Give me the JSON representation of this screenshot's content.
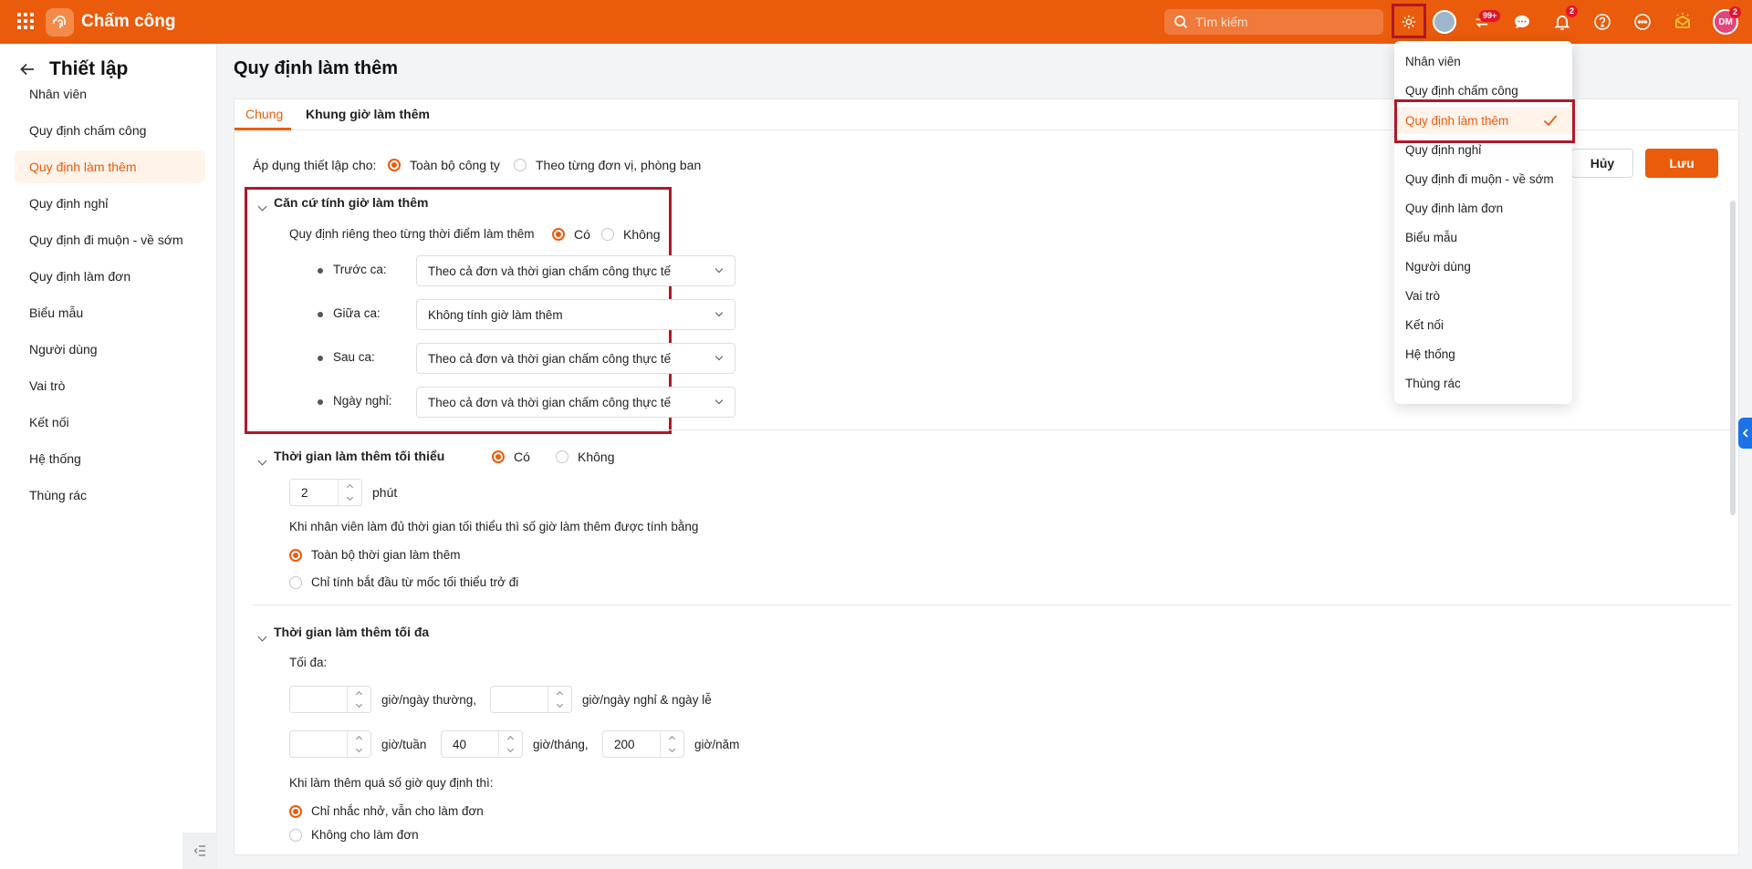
{
  "app": {
    "title": "Chấm công",
    "search_placeholder": "Tìm kiếm",
    "notif_badge": "99+",
    "bell_badge": "2",
    "avatar_initials": "DM",
    "avatar_badge": "2"
  },
  "sidebar": {
    "title": "Thiết lập",
    "items": [
      "Nhân viên",
      "Quy định chấm công",
      "Quy định làm thêm",
      "Quy định nghỉ",
      "Quy định đi muộn - về sớm",
      "Quy định làm đơn",
      "Biểu mẫu",
      "Người dùng",
      "Vai trò",
      "Kết nối",
      "Hệ thống",
      "Thùng rác"
    ],
    "active_index": 2
  },
  "page": {
    "title": "Quy định làm thêm"
  },
  "tabs": [
    "Chung",
    "Khung giờ làm thêm"
  ],
  "buttons": {
    "cancel": "Hủy",
    "save": "Lưu"
  },
  "apply": {
    "label": "Áp dụng thiết lập cho:",
    "options": [
      "Toàn bộ công ty",
      "Theo từng đơn vị, phòng ban"
    ],
    "selected": 0
  },
  "section1": {
    "title": "Căn cứ tính giờ làm thêm",
    "rule_label": "Quy định riêng theo từng thời điểm làm thêm",
    "rule_yes": "Có",
    "rule_no": "Không",
    "rows": [
      {
        "label": "Trước ca:",
        "value": "Theo cả đơn và thời gian chấm công thực tế"
      },
      {
        "label": "Giữa ca:",
        "value": "Không tính giờ làm thêm"
      },
      {
        "label": "Sau ca:",
        "value": "Theo cả đơn và thời gian chấm công thực tế"
      },
      {
        "label": "Ngày nghỉ:",
        "value": "Theo cả đơn và thời gian chấm công thực tế"
      }
    ]
  },
  "section2": {
    "title": "Thời gian làm thêm tối thiểu",
    "yes": "Có",
    "no": "Không",
    "minutes": "2",
    "unit": "phút",
    "calc_label": "Khi nhân viên làm đủ thời gian tối thiểu thì số giờ làm thêm được tính bằng",
    "calc_options": [
      "Toàn bộ thời gian làm thêm",
      "Chỉ tính bắt đầu từ mốc tối thiểu trở đi"
    ]
  },
  "section3": {
    "title": "Thời gian làm thêm tối đa",
    "max_label": "Tối đa:",
    "per_weekday": "giờ/ngày thường,",
    "per_holiday": "giờ/ngày nghỉ & ngày lễ",
    "per_week": "giờ/tuần",
    "month_value": "40",
    "per_month": "giờ/tháng,",
    "year_value": "200",
    "per_year": "giờ/năm",
    "exceed_label": "Khi làm thêm quá số giờ quy định thì:",
    "exceed_options": [
      "Chỉ nhắc nhở, vẫn cho làm đơn",
      "Không cho làm đơn"
    ]
  },
  "dropdown": {
    "items": [
      "Nhân viên",
      "Quy định chấm công",
      "Quy định làm thêm",
      "Quy định nghỉ",
      "Quy định đi muộn - về sớm",
      "Quy định làm đơn",
      "Biểu mẫu",
      "Người dùng",
      "Vai trò",
      "Kết nối",
      "Hệ thống",
      "Thùng rác"
    ],
    "active_index": 2
  },
  "colors": {
    "brand": "#ea5b0c",
    "highlight": "#b01828"
  }
}
